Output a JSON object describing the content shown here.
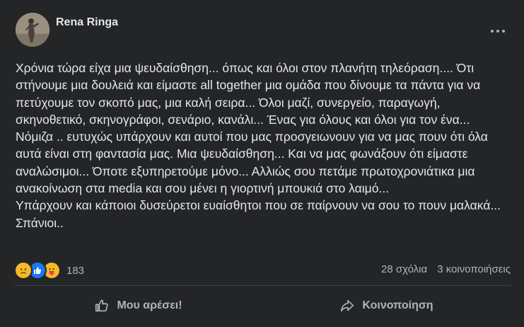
{
  "post": {
    "author": "Rena Ringa",
    "text": "Χρόνια τώρα είχα μια ψευδαίσθηση... όπως και όλοι στον πλανήτη τηλεόραση.... Ότι στήνουμε μια δουλειά και είμαστε all together μια ομάδα που δίνουμε τα πάντα για να πετύχουμε τον σκοπό μας, μια καλή σειρα... Όλοι μαζί, συνεργείο, παραγωγή, σκηνοθετικό, σκηνογράφοι, σενάριο, κανάλι... Ένας για όλους και όλοι για τον ένα... Νόμιζα .. ευτυχώς υπάρχουν και αυτοί που μας προσγειωνουν για να μας πουν ότι όλα αυτά είναι στη φαντασία μας. Μια ψευδαίσθηση... Και να μας φωνάξουν ότι είμαστε αναλώσιμοι... Όποτε εξυπηρετούμε μόνο... Αλλιώς σου πετάμε πρωτοχρονιάτικα μια ανακοίνωση στα media και σου μένει η γιορτινή μπουκιά στο λαιμό...\nΥπάρχουν και κάποιοι δυσεύρετοι ευαίσθητοι που σε παίρνουν να σου το πουν μαλακά... Σπάνιοι.."
  },
  "reactions": {
    "icons": [
      "sad-reaction",
      "like-reaction",
      "care-reaction"
    ],
    "count": "183"
  },
  "stats": {
    "comments": "28 σχόλια",
    "shares": "3 κοινοποιήσεις"
  },
  "actions": {
    "like_label": "Μου αρέσει!",
    "share_label": "Κοινοποίηση"
  },
  "colors": {
    "background": "#242526",
    "text": "#e4e6eb",
    "secondary": "#b0b3b8",
    "like_blue": "#1877f2",
    "reaction_yellow": "#f7b928"
  }
}
